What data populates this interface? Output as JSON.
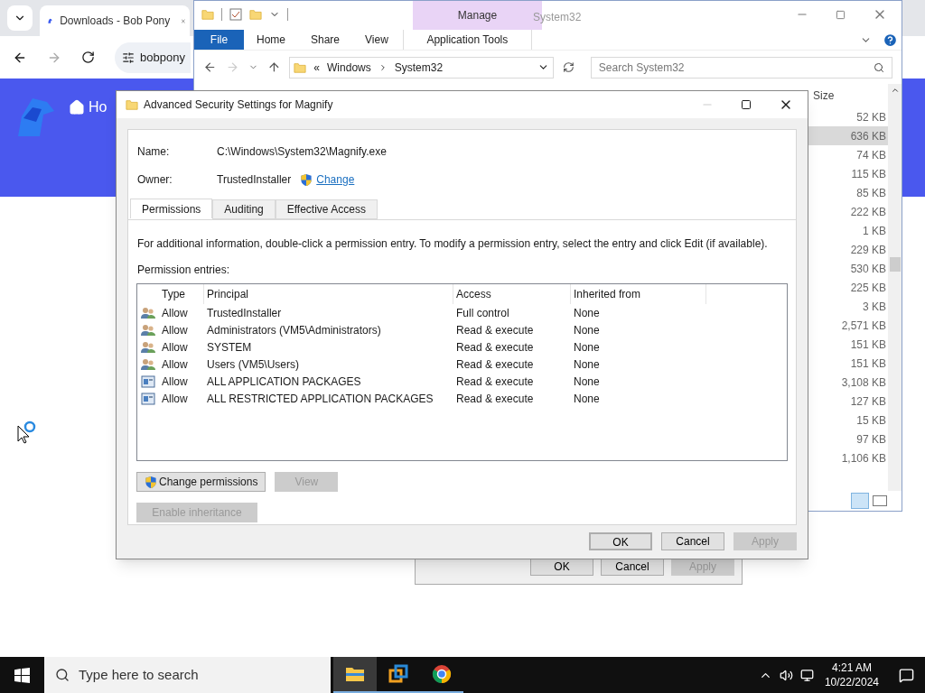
{
  "browser": {
    "tab_title": "Downloads - Bob Pony",
    "address": "bobpony",
    "nav_link": "Ho"
  },
  "explorer": {
    "title": "System32",
    "context_group": "Manage",
    "ribbon_tabs": [
      {
        "label": "File",
        "kind": "file"
      },
      {
        "label": "Home",
        "kind": "plain"
      },
      {
        "label": "Share",
        "kind": "plain"
      },
      {
        "label": "View",
        "kind": "plain"
      },
      {
        "label": "Application Tools",
        "kind": "context"
      }
    ],
    "path_prefix": "«",
    "path": [
      "Windows",
      "System32"
    ],
    "search": {
      "placeholder": "Search System32"
    },
    "size_column": "Size",
    "sizes": [
      {
        "value": "52 KB",
        "selected": false
      },
      {
        "value": "636 KB",
        "selected": true
      },
      {
        "value": "74 KB",
        "selected": false
      },
      {
        "value": "115 KB",
        "selected": false
      },
      {
        "value": "85 KB",
        "selected": false
      },
      {
        "value": "222 KB",
        "selected": false
      },
      {
        "value": "1 KB",
        "selected": false
      },
      {
        "value": "229 KB",
        "selected": false
      },
      {
        "value": "530 KB",
        "selected": false
      },
      {
        "value": "225 KB",
        "selected": false
      },
      {
        "value": "3 KB",
        "selected": false
      },
      {
        "value": "2,571 KB",
        "selected": false
      },
      {
        "value": "151 KB",
        "selected": false
      },
      {
        "value": "151 KB",
        "selected": false
      },
      {
        "value": "3,108 KB",
        "selected": false
      },
      {
        "value": "127 KB",
        "selected": false
      },
      {
        "value": "15 KB",
        "selected": false
      },
      {
        "value": "97 KB",
        "selected": false
      },
      {
        "value": "1,106 KB",
        "selected": false
      }
    ]
  },
  "properties_dialog": {
    "buttons": [
      {
        "label": "OK",
        "disabled": false
      },
      {
        "label": "Cancel",
        "disabled": false
      },
      {
        "label": "Apply",
        "disabled": true
      }
    ]
  },
  "dialog": {
    "title": "Advanced Security Settings for Magnify",
    "name_label": "Name:",
    "name_value": "C:\\Windows\\System32\\Magnify.exe",
    "owner_label": "Owner:",
    "owner_value": "TrustedInstaller",
    "change_link": "Change",
    "tabs": [
      {
        "label": "Permissions",
        "selected": true
      },
      {
        "label": "Auditing",
        "selected": false
      },
      {
        "label": "Effective Access",
        "selected": false
      }
    ],
    "description": "For additional information, double-click a permission entry. To modify a permission entry, select the entry and click Edit (if available).",
    "entries_label": "Permission entries:",
    "columns": [
      "Type",
      "Principal",
      "Access",
      "Inherited from"
    ],
    "entries": [
      {
        "kind": "users",
        "type": "Allow",
        "principal": "TrustedInstaller",
        "access": "Full control",
        "inherited": "None"
      },
      {
        "kind": "users",
        "type": "Allow",
        "principal": "Administrators (VM5\\Administrators)",
        "access": "Read & execute",
        "inherited": "None"
      },
      {
        "kind": "users",
        "type": "Allow",
        "principal": "SYSTEM",
        "access": "Read & execute",
        "inherited": "None"
      },
      {
        "kind": "users",
        "type": "Allow",
        "principal": "Users (VM5\\Users)",
        "access": "Read & execute",
        "inherited": "None"
      },
      {
        "kind": "package",
        "type": "Allow",
        "principal": "ALL APPLICATION PACKAGES",
        "access": "Read & execute",
        "inherited": "None"
      },
      {
        "kind": "package",
        "type": "Allow",
        "principal": "ALL RESTRICTED APPLICATION PACKAGES",
        "access": "Read & execute",
        "inherited": "None"
      }
    ],
    "actions": [
      {
        "label": "Change permissions",
        "disabled": false,
        "shield": true
      },
      {
        "label": "View",
        "disabled": true,
        "shield": false
      }
    ],
    "inheritance_button": {
      "label": "Enable inheritance",
      "disabled": true
    },
    "buttons": [
      {
        "label": "OK",
        "disabled": false,
        "default": true
      },
      {
        "label": "Cancel",
        "disabled": false,
        "default": false
      },
      {
        "label": "Apply",
        "disabled": true,
        "default": false
      }
    ]
  },
  "taskbar": {
    "search_placeholder": "Type here to search",
    "apps": [
      {
        "kind": "explorer",
        "active": true
      },
      {
        "kind": "vm",
        "active": false
      },
      {
        "kind": "chrome",
        "active": false
      }
    ],
    "time": "4:21 AM",
    "date": "10/22/2024"
  }
}
